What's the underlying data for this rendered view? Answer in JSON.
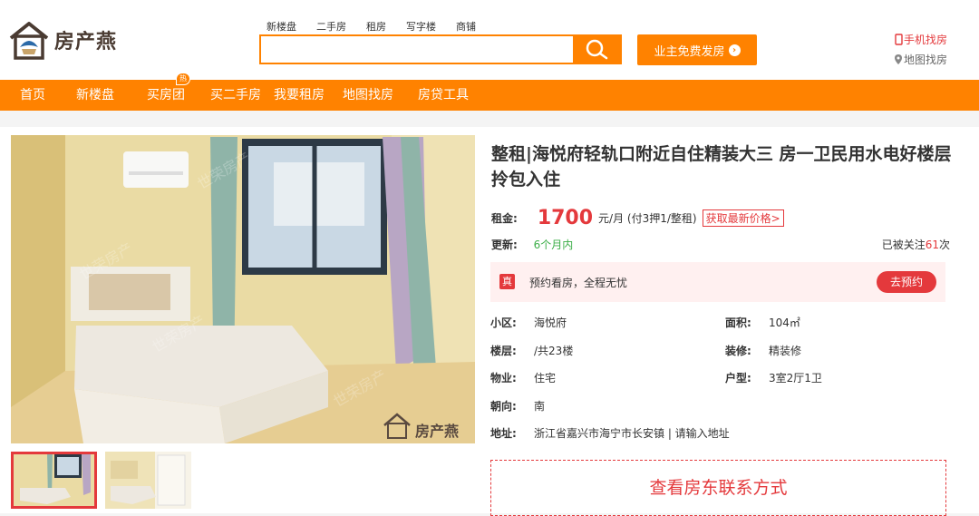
{
  "brand": {
    "name": "房产燕"
  },
  "search": {
    "tabs": [
      "新楼盘",
      "二手房",
      "租房",
      "写字楼",
      "商铺"
    ],
    "placeholder": ""
  },
  "header": {
    "post_button": "业主免费发房",
    "mobile_link": "手机找房",
    "map_link": "地图找房"
  },
  "nav": {
    "items": [
      "首页",
      "新楼盘",
      "买房团",
      "买二手房",
      "我要租房",
      "地图找房",
      "房贷工具"
    ],
    "badge": "热"
  },
  "gallery": {
    "watermark": "世荣房产",
    "logo_watermark": "房产燕"
  },
  "listing": {
    "title": "整租|海悦府轻轨口附近自住精装大三 房一卫民用水电好楼层拎包入住",
    "price_label": "租金:",
    "price": "1700",
    "price_unit": "元/月 (付3押1/整租)",
    "price_link": "获取最新价格>",
    "update_label": "更新:",
    "update_value": "6个月内",
    "watch_prefix": "已被关注",
    "watch_count": "61",
    "watch_suffix": "次",
    "banner_icon": "真",
    "banner_text": "预约看房，全程无忧",
    "book_button": "去预约",
    "info": [
      {
        "k": "小区:",
        "v": "海悦府"
      },
      {
        "k": "面积:",
        "v": "104㎡"
      },
      {
        "k": "楼层:",
        "v": "/共23楼"
      },
      {
        "k": "装修:",
        "v": "精装修"
      },
      {
        "k": "物业:",
        "v": "住宅"
      },
      {
        "k": "户型:",
        "v": "3室2厅1卫"
      },
      {
        "k": "朝向:",
        "v": "南"
      },
      {
        "k": "地址:",
        "v": "浙江省嘉兴市海宁市长安镇 | 请输入地址"
      }
    ],
    "contact_button": "查看房东联系方式"
  },
  "colors": {
    "accent": "#ff8200",
    "red": "#e4393c",
    "green": "#3cae48"
  }
}
